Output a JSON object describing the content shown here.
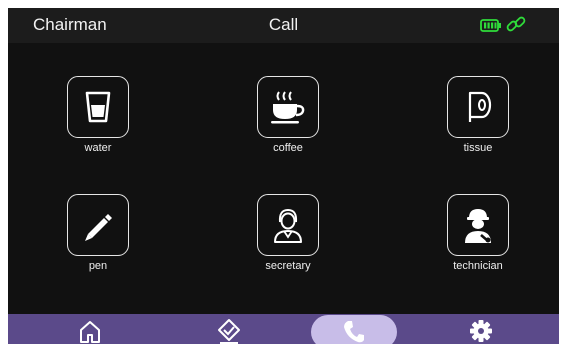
{
  "header": {
    "left_title": "Chairman",
    "center_title": "Call"
  },
  "status": {
    "battery_color": "#2fdc3a",
    "link_color": "#2fdc3a",
    "battery_icon": "battery-icon",
    "link_icon": "link-icon"
  },
  "services": [
    {
      "label": "water",
      "icon": "water-glass-icon"
    },
    {
      "label": "coffee",
      "icon": "coffee-cup-icon"
    },
    {
      "label": "tissue",
      "icon": "tissue-roll-icon"
    },
    {
      "label": "pen",
      "icon": "pen-icon"
    },
    {
      "label": "secretary",
      "icon": "secretary-icon"
    },
    {
      "label": "technician",
      "icon": "technician-icon"
    }
  ],
  "nav": {
    "items": [
      "home-icon",
      "check-icon",
      "phone-icon",
      "settings-icon"
    ],
    "active": "phone-icon",
    "bar_color": "#5b4a8a",
    "active_color": "#c8bde8"
  }
}
